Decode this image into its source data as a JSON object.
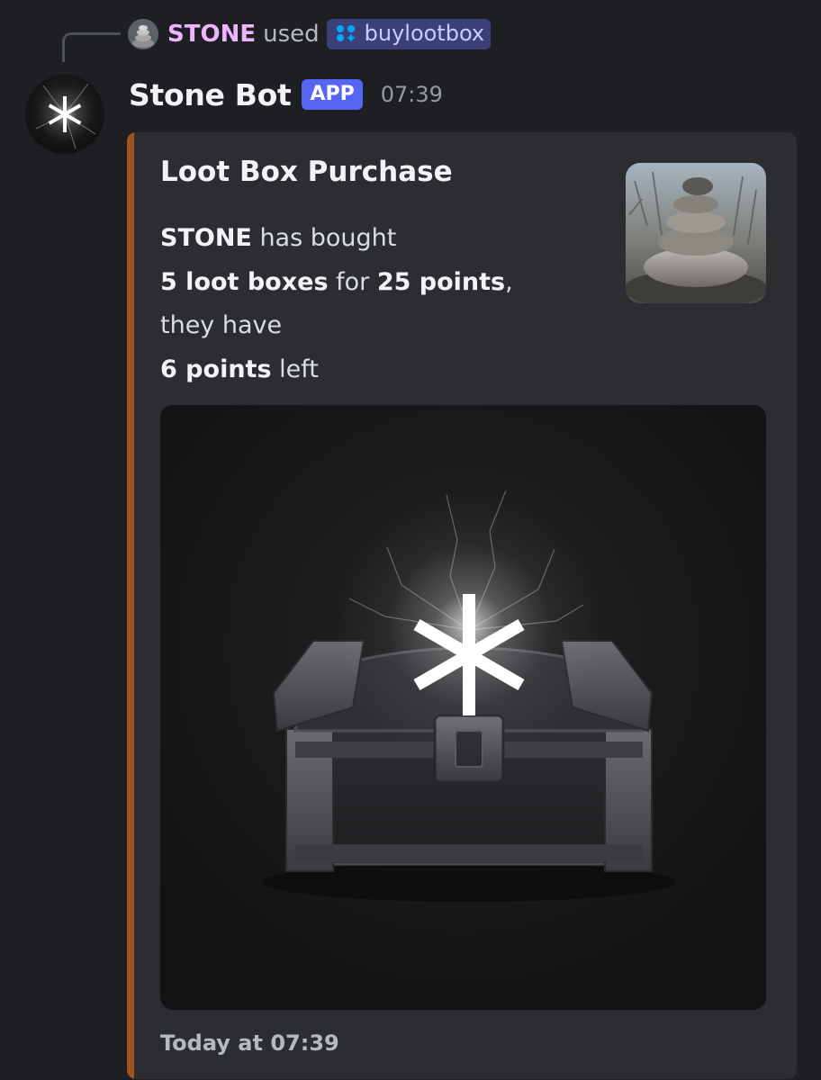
{
  "reference": {
    "user": "STONE",
    "action": "used",
    "command": "buylootbox",
    "user_color": "#f0b3ff"
  },
  "message": {
    "author": "Stone Bot",
    "badge": "APP",
    "time": "07:39"
  },
  "embed": {
    "accent_color": "#a0521f",
    "title": "Loot Box Purchase",
    "description": {
      "line1": {
        "bold": "STONE",
        "rest": " has bought"
      },
      "line2": {
        "bold1": "5 loot boxes",
        "mid": " for ",
        "bold2": "25 points",
        "end": ","
      },
      "line3": "they have",
      "line4": {
        "bold": "6 points",
        "rest": " left"
      }
    },
    "thumbnail_icon": "stacked-stones-icon",
    "image_icon": "glowing-treasure-chest-icon",
    "footer": "Today at 07:39"
  },
  "colors": {
    "background": "#1e1f22",
    "embed_background": "#2b2d31",
    "app_badge": "#5865f2",
    "command_chip": "#3b4178"
  }
}
